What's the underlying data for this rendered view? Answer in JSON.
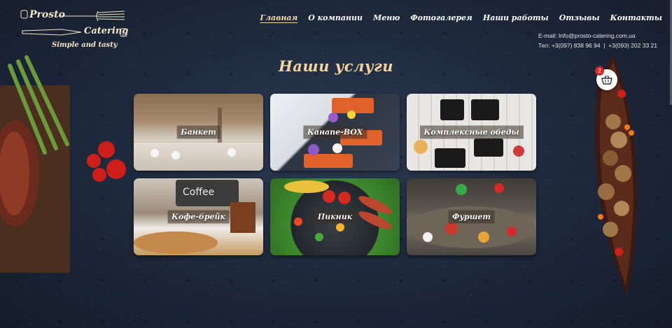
{
  "logo": {
    "brand_part1": "Prosto",
    "brand_part2": "Catering",
    "slogan": "Simple and tasty"
  },
  "nav": {
    "items": [
      {
        "label": "Главная",
        "active": true
      },
      {
        "label": "О компании",
        "active": false
      },
      {
        "label": "Меню",
        "active": false
      },
      {
        "label": "Фотогалерея",
        "active": false
      },
      {
        "label": "Наши работы",
        "active": false
      },
      {
        "label": "Отзывы",
        "active": false
      },
      {
        "label": "Контакты",
        "active": false
      }
    ]
  },
  "contacts": {
    "email_label": "E-mail:",
    "email": "Info@prosto-catering.com.ua",
    "phone_label": "Тел:",
    "phone1": "+3(097) 838 96 94",
    "separator": "|",
    "phone2": "+3(093) 202 33 21"
  },
  "services": {
    "title": "Наши услуги",
    "cards": [
      {
        "label": "Банкет"
      },
      {
        "label": "Канапе-BOX"
      },
      {
        "label": "Комплексные обеды"
      },
      {
        "label": "Кофе-брейк"
      },
      {
        "label": "Пикник"
      },
      {
        "label": "Фуршет"
      }
    ]
  },
  "cart": {
    "count": "2",
    "icon": "basket-icon"
  },
  "colors": {
    "accent_gold": "#f2d49a",
    "nav_active": "#f2d9a6",
    "badge": "#d42a2a"
  }
}
